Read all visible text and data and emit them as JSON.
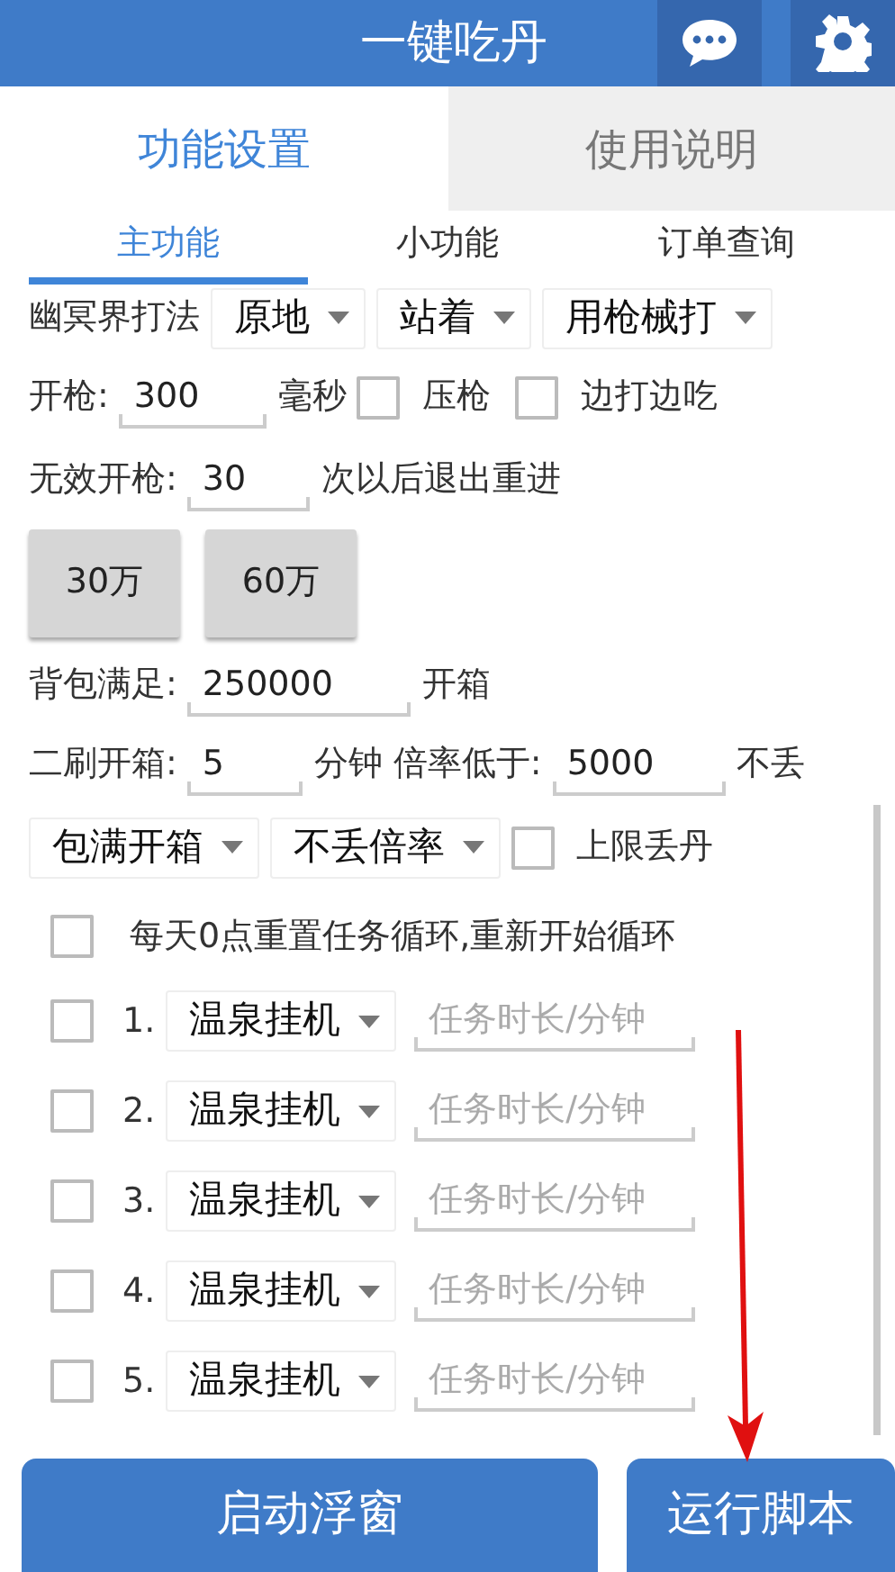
{
  "app_bar": {
    "title": "一键吃丹"
  },
  "tabs": [
    {
      "label": "功能设置",
      "selected": true
    },
    {
      "label": "使用说明",
      "selected": false
    }
  ],
  "sub_tabs": [
    {
      "label": "主功能",
      "selected": true
    },
    {
      "label": "小功能",
      "selected": false
    },
    {
      "label": "订单查询",
      "selected": false
    }
  ],
  "form_rows": [
    [
      {
        "kind": "label",
        "text": "幽冥界打法"
      },
      {
        "kind": "spinner",
        "value": "原地"
      },
      {
        "kind": "spinner",
        "value": "站着"
      },
      {
        "kind": "spinner",
        "value": "用枪械打"
      }
    ],
    [
      {
        "kind": "label",
        "text": "开枪:"
      },
      {
        "kind": "field",
        "value": "300"
      },
      {
        "kind": "label",
        "text": "毫秒"
      },
      {
        "kind": "checkbox",
        "label": "压枪",
        "checked": false
      },
      {
        "kind": "checkbox",
        "label": "边打边吃",
        "checked": false
      }
    ],
    [
      {
        "kind": "label",
        "text": "无效开枪:"
      },
      {
        "kind": "field",
        "value": "30"
      },
      {
        "kind": "label",
        "text": "次以后退出重进"
      }
    ],
    [
      {
        "kind": "button",
        "label": "30万"
      },
      {
        "kind": "button",
        "label": "60万"
      }
    ],
    [
      {
        "kind": "label",
        "text": "背包满足:"
      },
      {
        "kind": "field",
        "value": "250000"
      },
      {
        "kind": "label",
        "text": "开箱"
      }
    ],
    [
      {
        "kind": "label",
        "text": "二刷开箱:"
      },
      {
        "kind": "field",
        "value": "5"
      },
      {
        "kind": "label",
        "text": "分钟"
      },
      {
        "kind": "label",
        "text": "倍率低于:"
      },
      {
        "kind": "field",
        "value": "5000"
      },
      {
        "kind": "label",
        "text": "不丢"
      }
    ],
    [
      {
        "kind": "spinner",
        "value": "包满开箱"
      },
      {
        "kind": "spinner",
        "value": "不丢倍率"
      },
      {
        "kind": "checkbox",
        "label": "上限丢丹",
        "checked": false
      }
    ]
  ],
  "daily_reset": {
    "label": "每天0点重置任务循环,重新开始循环",
    "checked": false
  },
  "tasks": [
    {
      "number": "1.",
      "checked": false,
      "activity": "温泉挂机",
      "placeholder": "任务时长/分钟"
    },
    {
      "number": "2.",
      "checked": false,
      "activity": "温泉挂机",
      "placeholder": "任务时长/分钟"
    },
    {
      "number": "3.",
      "checked": false,
      "activity": "温泉挂机",
      "placeholder": "任务时长/分钟"
    },
    {
      "number": "4.",
      "checked": false,
      "activity": "温泉挂机",
      "placeholder": "任务时长/分钟"
    },
    {
      "number": "5.",
      "checked": false,
      "activity": "温泉挂机",
      "placeholder": "任务时长/分钟"
    }
  ],
  "bottom_buttons": [
    "启动浮窗",
    "运行脚本"
  ]
}
